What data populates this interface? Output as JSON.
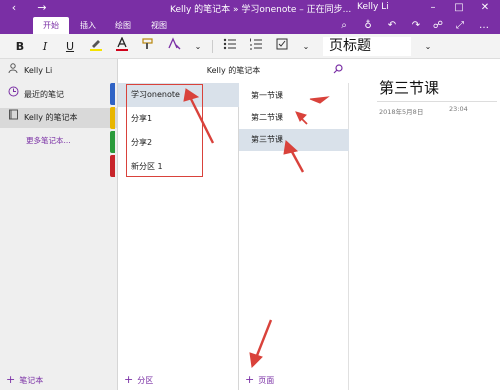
{
  "titlebar": {
    "title": "Kelly 的笔记本 » 学习onenote – 正在同步...",
    "user": "Kelly Li"
  },
  "tabs": [
    {
      "label": "开始"
    },
    {
      "label": "插入"
    },
    {
      "label": "绘图"
    },
    {
      "label": "视图"
    }
  ],
  "toolbar": {
    "style_value": "页标题"
  },
  "leftnav": {
    "user": "Kelly Li",
    "items": [
      {
        "label": "最近的笔记"
      },
      {
        "label": "Kelly 的笔记本"
      }
    ],
    "more_link": "更多笔记本...",
    "add_label": "笔记本"
  },
  "notebook": {
    "header": "Kelly 的笔记本",
    "sections": [
      {
        "label": "学习onenote",
        "color": "#2f63c5"
      },
      {
        "label": "分享1",
        "color": "#e8b600"
      },
      {
        "label": "分享2",
        "color": "#2a9b3b"
      },
      {
        "label": "新分区 1",
        "color": "#c8252b"
      }
    ],
    "add_section_label": "分区"
  },
  "pages": {
    "items": [
      {
        "label": "第一节课"
      },
      {
        "label": "第二节课"
      },
      {
        "label": "第三节课"
      }
    ],
    "add_page_label": "页面"
  },
  "content": {
    "title": "第三节课",
    "date": "2018年5月8日",
    "time": "23:04"
  },
  "colors": {
    "brand": "#7a2fa5",
    "selection": "#d9e1ea",
    "annotation": "#d9423b"
  }
}
